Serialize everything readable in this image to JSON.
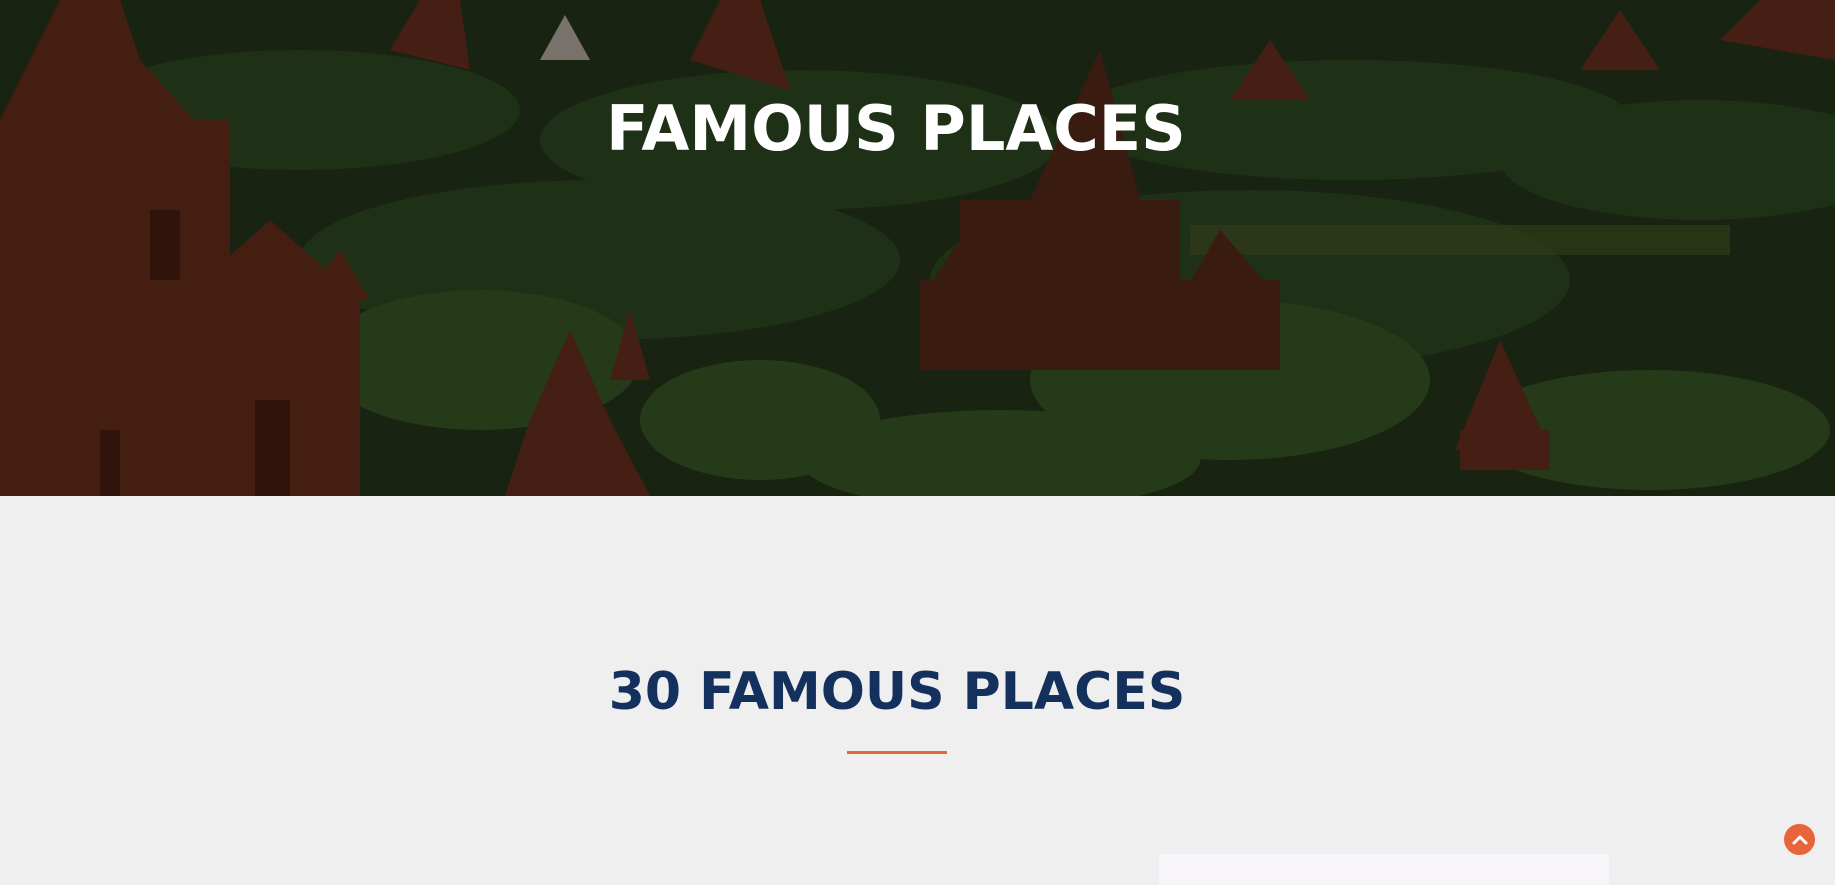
{
  "hero": {
    "title": "FAMOUS PLACES",
    "image_icon": "bagan-temples-landscape"
  },
  "section": {
    "title": "30 FAMOUS PLACES",
    "accent_color": "#e8643c",
    "title_color": "#13315c"
  },
  "controls": {
    "scroll_top_icon": "chevron-up-icon"
  }
}
